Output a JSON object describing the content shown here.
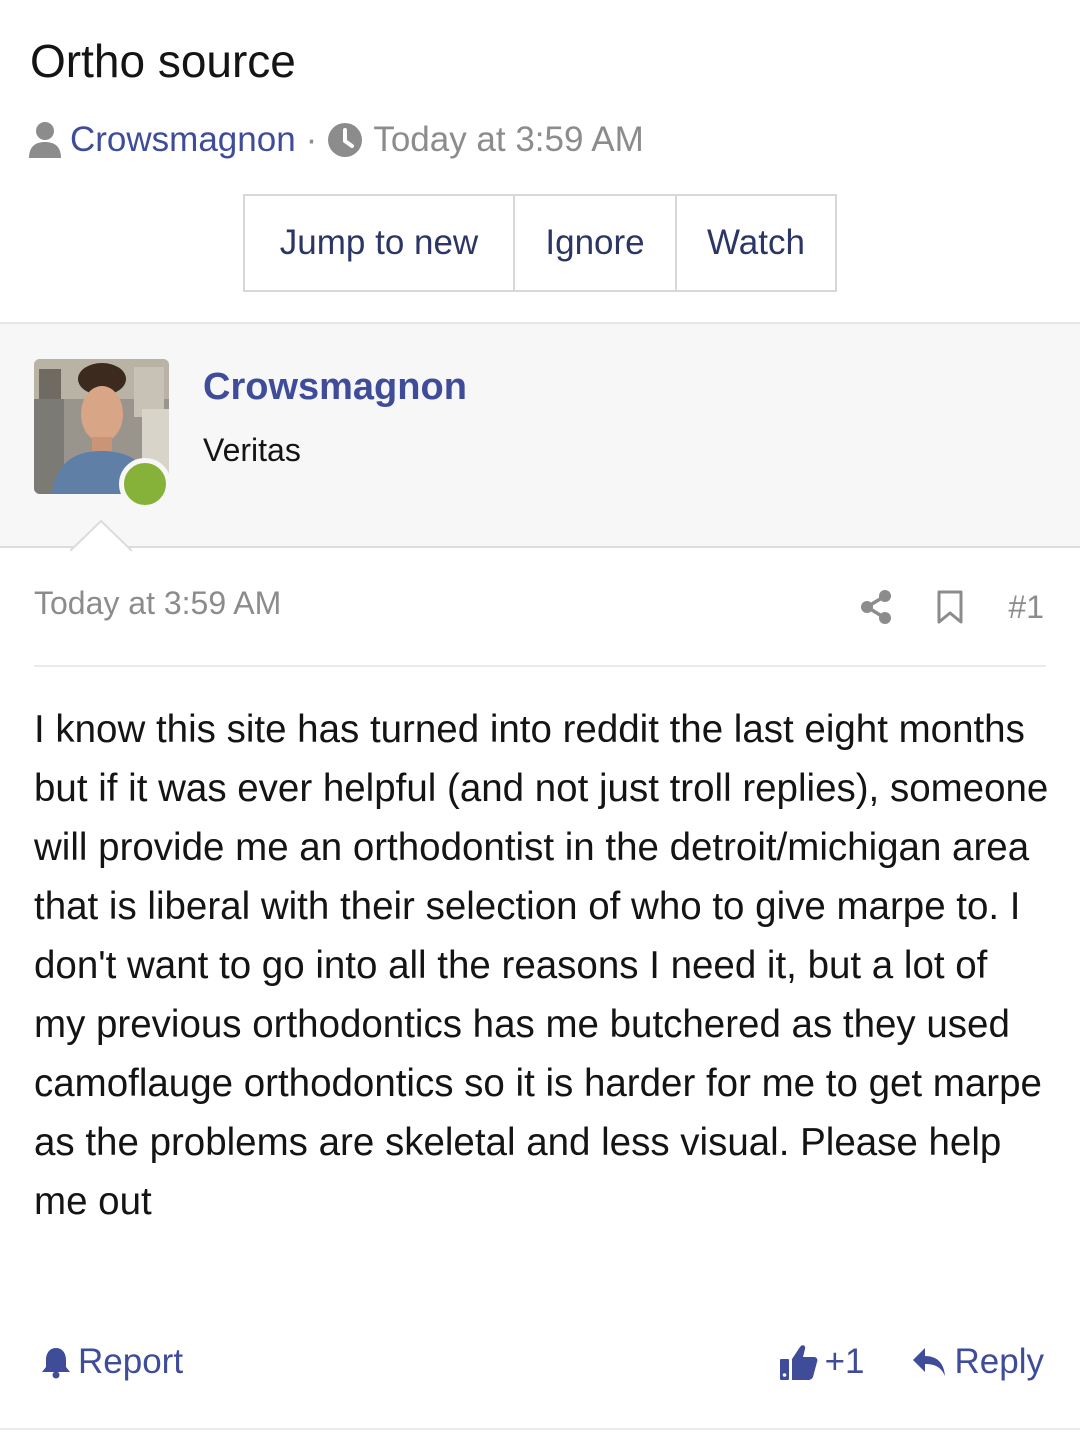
{
  "thread": {
    "title": "Ortho source",
    "author": "Crowsmagnon",
    "separator": "·",
    "date": "Today at 3:59 AM"
  },
  "buttons": {
    "jump_to_new": "Jump to new",
    "ignore": "Ignore",
    "watch": "Watch"
  },
  "user": {
    "name": "Crowsmagnon",
    "title": "Veritas",
    "online": true
  },
  "post": {
    "date": "Today at 3:59 AM",
    "number": "#1",
    "body": "I know this site has turned into reddit the last eight months but if it was ever helpful (and not just troll replies), someone will provide me an orthodontist in the detroit/michigan area that is liberal with their selection of who to give marpe to. I don't want to go into all the reasons I need it, but a lot of my previous orthodontics has me butchered as they used camoflauge orthodontics so it is harder for me to get marpe as the problems are skeletal and less visual. Please help me out"
  },
  "footer": {
    "report": "Report",
    "reaction_count": "+1",
    "reply": "Reply"
  },
  "colors": {
    "link": "#3f4c99",
    "muted": "#8c8c8c",
    "online": "#87b23a"
  },
  "icons": [
    "user-icon",
    "clock-icon",
    "share-icon",
    "bookmark-icon",
    "bell-icon",
    "thumbs-up-icon",
    "reply-icon"
  ]
}
